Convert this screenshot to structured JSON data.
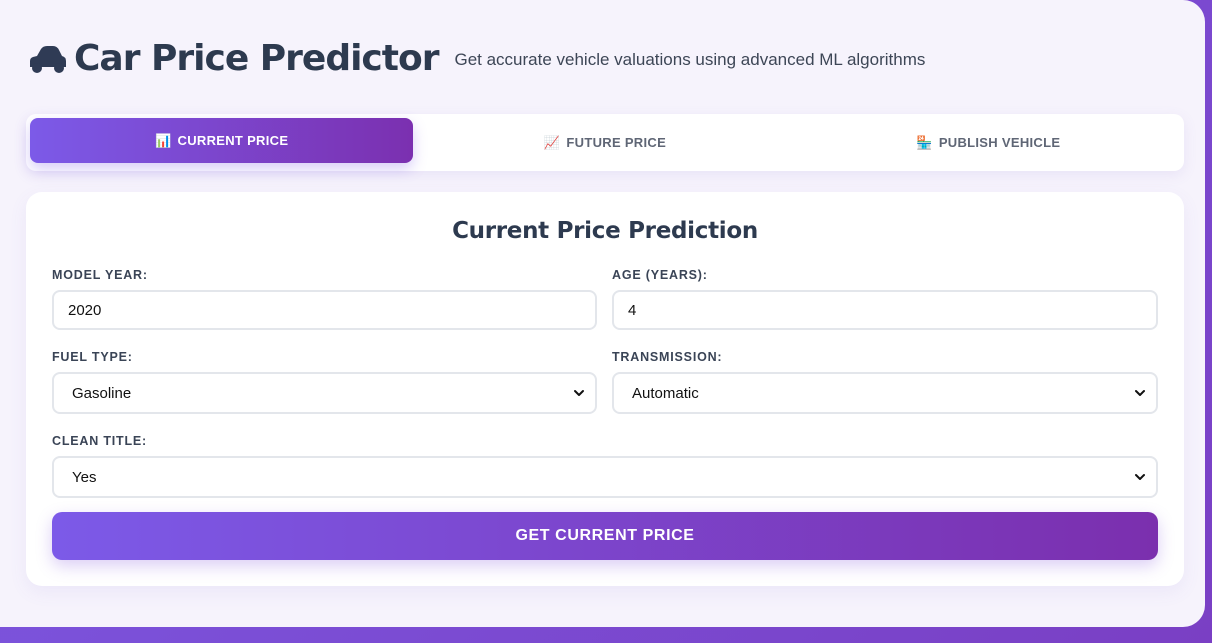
{
  "header": {
    "icon": "car-icon",
    "title": "Car Price Predictor",
    "subtitle": "Get accurate vehicle valuations using advanced ML algorithms"
  },
  "tabs": [
    {
      "emoji": "📊",
      "label": "CURRENT PRICE",
      "active": true
    },
    {
      "emoji": "📈",
      "label": "FUTURE PRICE",
      "active": false
    },
    {
      "emoji": "🏪",
      "label": "PUBLISH VEHICLE",
      "active": false
    }
  ],
  "form": {
    "title": "Current Price Prediction",
    "model_year": {
      "label": "MODEL YEAR:",
      "value": "2020"
    },
    "age": {
      "label": "AGE (YEARS):",
      "value": "4"
    },
    "fuel_type": {
      "label": "FUEL TYPE:",
      "value": "Gasoline"
    },
    "transmission": {
      "label": "TRANSMISSION:",
      "value": "Automatic"
    },
    "clean_title": {
      "label": "CLEAN TITLE:",
      "value": "Yes"
    },
    "submit_label": "GET CURRENT PRICE"
  },
  "colors": {
    "accent_start": "#7c5ae8",
    "accent_end": "#7b2fae",
    "background": "#f6f3fc"
  }
}
